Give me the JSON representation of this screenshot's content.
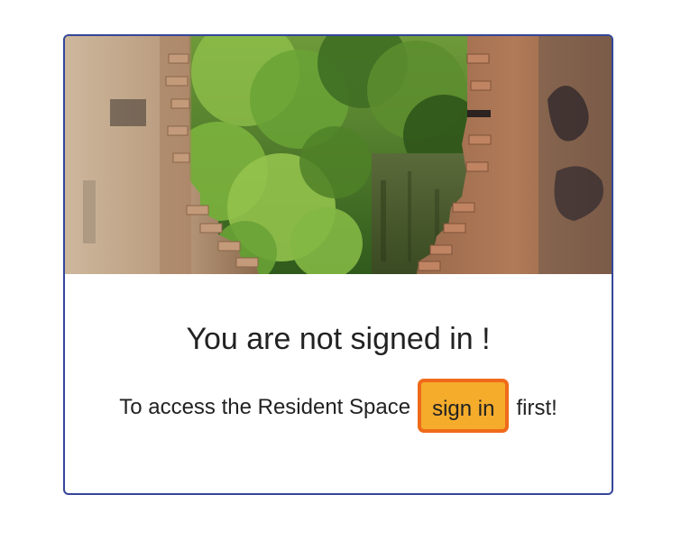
{
  "card": {
    "title": "You are not signed in !",
    "message_before": "To access the Resident Space",
    "signin_label": "sign in",
    "message_after": "first!"
  },
  "colors": {
    "card_border": "#34469a",
    "button_fill": "#f5ac2b",
    "button_border": "#ef6a1a"
  }
}
